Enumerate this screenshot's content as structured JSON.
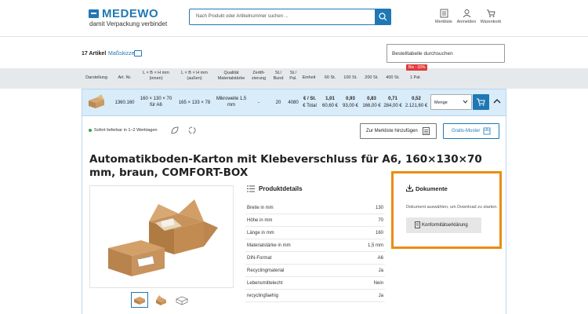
{
  "header": {
    "logo": "MEDEWO",
    "tagline": "damit Verpackung verbindet",
    "search_placeholder": "Nach Produkt oder Artikelnummer suchen ...",
    "icons": [
      {
        "name": "clipboard-list-icon",
        "label": "Merkliste"
      },
      {
        "name": "user-icon",
        "label": "Anmelden"
      },
      {
        "name": "cart-icon",
        "label": "Warenkorb"
      }
    ]
  },
  "toolbar": {
    "count": "17 Artikel",
    "sketch_link": "Maßskizze",
    "table_search": "Bestelltabelle durchsuchen"
  },
  "table": {
    "headers": [
      {
        "key": "darstellung",
        "label": "Darstellung"
      },
      {
        "key": "artnr",
        "label": "Art. Nr."
      },
      {
        "key": "innen",
        "label": "L × B × H mm (innen)"
      },
      {
        "key": "aussen",
        "label": "L × B × H mm (außen)"
      },
      {
        "key": "qualitaet",
        "label": "Qualität Materialstärke"
      },
      {
        "key": "zert",
        "label": "Zertifi-zierung"
      },
      {
        "key": "bund",
        "label": "St./ Bund"
      },
      {
        "key": "pal",
        "label": "St./ Pal."
      },
      {
        "key": "einheit",
        "label": "Einheit"
      },
      {
        "key": "st60",
        "label": "60 St."
      },
      {
        "key": "st100",
        "label": "100 St."
      },
      {
        "key": "st200",
        "label": "200 St."
      },
      {
        "key": "st400",
        "label": "400 St."
      },
      {
        "key": "pal1",
        "label": "1 Pal."
      }
    ],
    "discount_badge": "Bis - 33%",
    "row": {
      "artnr": "1360.160",
      "innen": "160 × 130 × 70 für A6",
      "aussen": "165 × 133 × 78",
      "qualitaet": "Mikrowelle 1,5 mm",
      "zert": "-",
      "bund": "20",
      "pal": "4080",
      "einheit_1": "€ / St.",
      "einheit_2": "€ Total",
      "prices": [
        {
          "unit": "1,01",
          "total": "60,60 €"
        },
        {
          "unit": "0,93",
          "total": "93,00 €"
        },
        {
          "unit": "0,83",
          "total": "166,00 €"
        },
        {
          "unit": "0,71",
          "total": "284,00 €"
        },
        {
          "unit": "0,52",
          "total": "2.121,60 €"
        }
      ],
      "qty_placeholder": "Menge"
    }
  },
  "detail": {
    "stock": "Sofort lieferbar in 1–2 Werktagen",
    "merkliste_btn": "Zur Merkliste hinzufügen",
    "muster_btn": "Gratis-Muster",
    "title": "Automatikboden-Karton mit Klebeverschluss für A6, 160×130×70 mm, braun, COMFORT-BOX",
    "productdetails_title": "Produktdetails",
    "specs": [
      {
        "label": "Breite in mm",
        "value": "130"
      },
      {
        "label": "Höhe in mm",
        "value": "70"
      },
      {
        "label": "Länge in mm",
        "value": "160"
      },
      {
        "label": "Materialstärke in mm",
        "value": "1,5 mm"
      },
      {
        "label": "DIN-Format",
        "value": "A6"
      },
      {
        "label": "Recyclingmaterial",
        "value": "Ja"
      },
      {
        "label": "Lebensmittelecht",
        "value": "Nein"
      },
      {
        "label": "recyclingfaehig",
        "value": "Ja"
      }
    ],
    "documents": {
      "title": "Dokumente",
      "description": "Dokument auswählen, um Download zu starten.",
      "button": "Konformitätserklärung"
    }
  },
  "colors": {
    "brand": "#1f78b4",
    "highlight": "#e88f10",
    "badge": "#e03b3b",
    "stock": "#34a853"
  }
}
